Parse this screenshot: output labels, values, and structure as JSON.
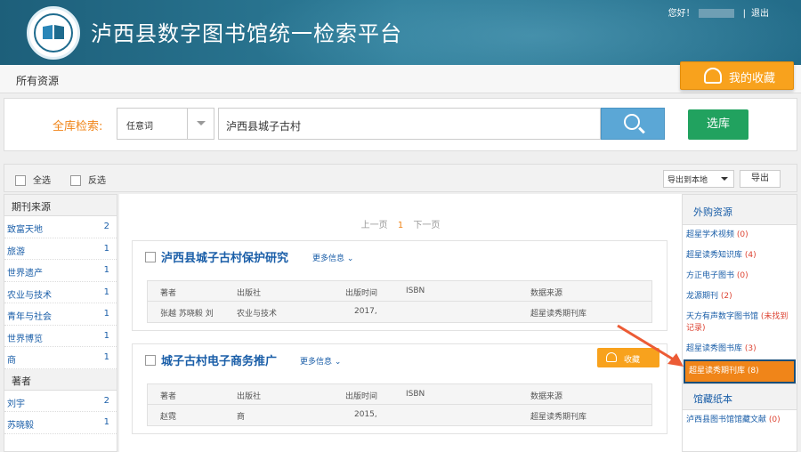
{
  "header": {
    "site_title": "泸西县数字图书馆统一检索平台",
    "greeting": "您好！",
    "logout": "退出"
  },
  "nav": {
    "all_resources": "所有资源",
    "my_favorites": "我的收藏"
  },
  "search": {
    "label": "全库检索:",
    "field_type": "任意词",
    "query": "泸西县城子古村",
    "select_library": "选库"
  },
  "toolbar": {
    "select_all": "全选",
    "invert_select": "反选",
    "export_option": "导出到本地",
    "export_button": "导出"
  },
  "left_facets": {
    "journal_source_header": "期刊来源",
    "journal_sources": [
      {
        "label": "致富天地",
        "count": "2"
      },
      {
        "label": "旅游",
        "count": "1"
      },
      {
        "label": "世界遗产",
        "count": "1"
      },
      {
        "label": "农业与技术",
        "count": "1"
      },
      {
        "label": "青年与社会",
        "count": "1"
      },
      {
        "label": "世界博览",
        "count": "1"
      },
      {
        "label": "商",
        "count": "1"
      }
    ],
    "author_header": "著者",
    "authors": [
      {
        "label": "刘宇",
        "count": "2"
      },
      {
        "label": "苏晓毅",
        "count": "1"
      }
    ]
  },
  "pager": {
    "prev": "上一页",
    "current": "1",
    "next": "下一页"
  },
  "results": [
    {
      "title": "泸西县城子古村保护研究",
      "more": "更多信息",
      "headers": [
        "著者",
        "出版社",
        "出版时间",
        "ISBN",
        "数据来源"
      ],
      "author": "张越 苏晓毅 刘",
      "publisher": "农业与技术",
      "date": "2017,",
      "isbn": "",
      "source": "超星读秀期刊库"
    },
    {
      "title": "城子古村电子商务推广",
      "more": "更多信息",
      "favorite": "收藏",
      "headers": [
        "著者",
        "出版社",
        "出版时间",
        "ISBN",
        "数据来源"
      ],
      "author": "赵霓",
      "publisher": "商",
      "date": "2015,",
      "isbn": "",
      "source": "超星读秀期刊库"
    }
  ],
  "right_panel": {
    "purchased_header": "外购资源",
    "items": [
      {
        "label": "超星学术视频",
        "count": "(0)"
      },
      {
        "label": "超星读秀知识库",
        "count": "(4)"
      },
      {
        "label": "方正电子图书",
        "count": "(0)"
      },
      {
        "label": "龙源期刊",
        "count": "(2)"
      },
      {
        "label": "天方有声数字图书馆",
        "count": "(未找到记录)"
      },
      {
        "label": "超星读秀图书库",
        "count": "(3)"
      },
      {
        "label": "超星读秀期刊库",
        "count": "(8)"
      }
    ],
    "collection_header": "馆藏纸本",
    "collection_items": [
      {
        "label": "泸西县图书馆馆藏文献",
        "count": "(0)"
      }
    ]
  },
  "colors": {
    "header_bg": "#2e7d99",
    "accent_orange": "#f8a21d",
    "search_blue": "#5ba7d6",
    "select_green": "#21a25f",
    "link_blue": "#1a5ea8",
    "arrow_red": "#ec5b35"
  }
}
